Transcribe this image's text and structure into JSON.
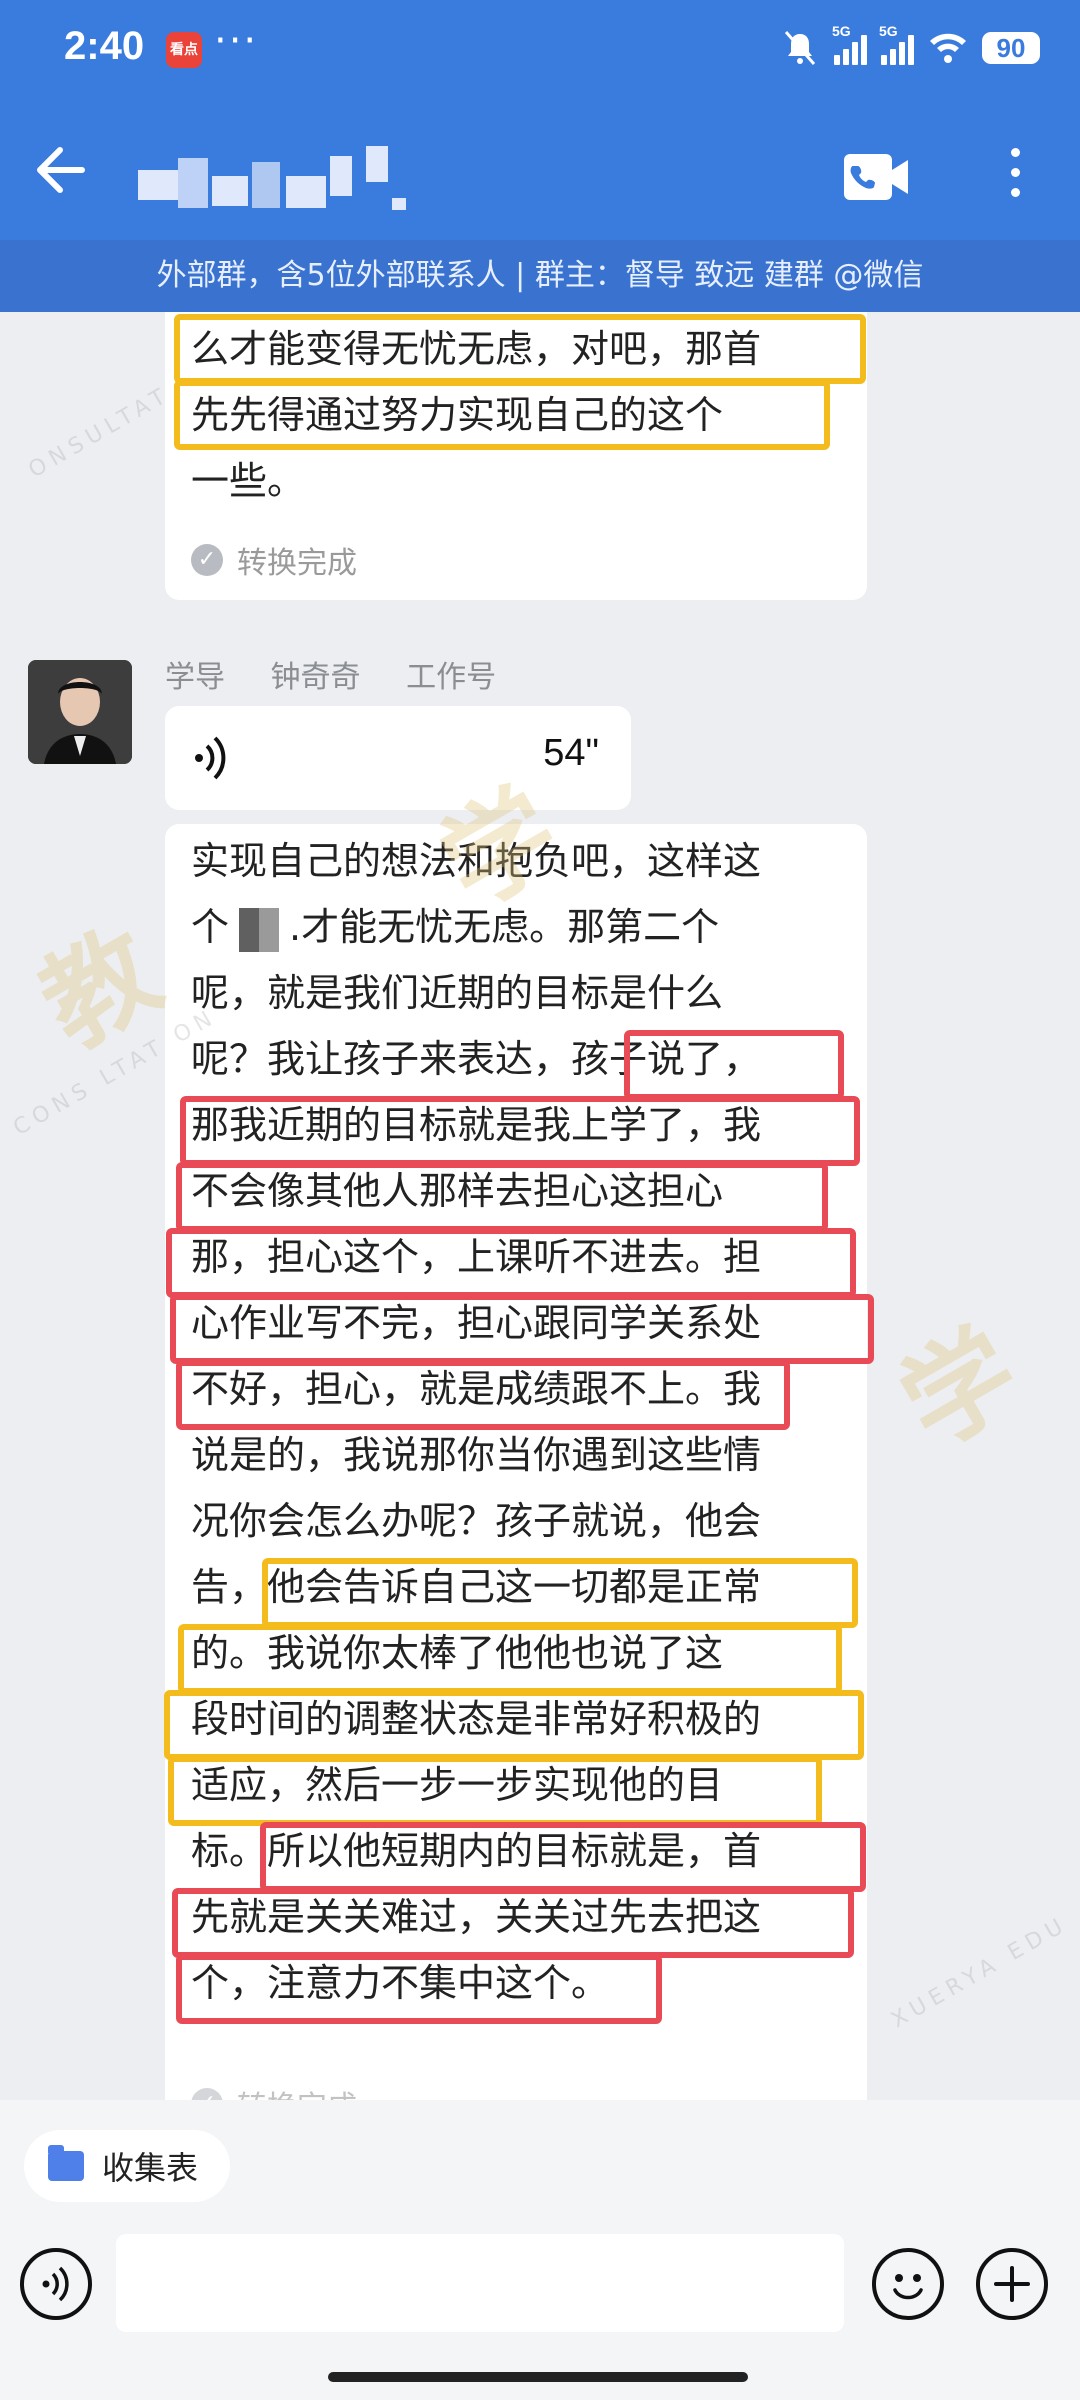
{
  "status_bar": {
    "time": "2:40",
    "app_icon_label": "看点",
    "overflow": "···",
    "signal_1": "5G",
    "signal_2": "5G",
    "battery": "90"
  },
  "header": {
    "title_obscured": "",
    "subtitle": "外部群，含5位外部联系人 | 群主：督导  致远    建群 @微信"
  },
  "messages": [
    {
      "lines": [
        "么才能变得无忧无虑，对吧，那首",
        "先先得通过努力实现自己的这个",
        "一些。"
      ],
      "status": "转换完成"
    },
    {
      "sender": "学导    钟奇奇    工作号",
      "voice_duration": "54\"",
      "lines": [
        {
          "pre": "实现自己的想法和抱负吧，这样这"
        },
        {
          "pre": "个",
          "post": ".才能无忧无虑。那第二个"
        },
        {
          "pre": "呢，就是我们近期的目标是什么"
        },
        {
          "pre": "呢？我让孩子来表达，孩子说了，"
        },
        {
          "pre": "那我近期的目标就是我上学了，我"
        },
        {
          "pre": "不会像其他人那样去担心这担心"
        },
        {
          "pre": "那，担心这个，上课听不进去。担"
        },
        {
          "pre": "心作业写不完，担心跟同学关系处"
        },
        {
          "pre": "不好，担心，就是成绩跟不上。我"
        },
        {
          "pre": "说是的，我说那你当你遇到这些情"
        },
        {
          "pre": "况你会怎么办呢？孩子就说，他会"
        },
        {
          "pre": "告，他会告诉自己这一切都是正常"
        },
        {
          "pre": "的。我说你太棒了他他也说了这"
        },
        {
          "pre": "段时间的调整状态是非常好积极的"
        },
        {
          "pre": "适应，然后一步一步实现他的目"
        },
        {
          "pre": "标。所以他短期内的目标就是，首"
        },
        {
          "pre": "先就是关关难过，关关过先去把这"
        },
        {
          "pre": "个，注意力不集中这个。"
        }
      ],
      "status_partial": "转换完成"
    }
  ],
  "bottom": {
    "chip_label": "收集表"
  },
  "icons": {
    "back": "back-arrow-icon",
    "call": "video-call-icon",
    "more": "more-vert-icon",
    "voice": "voice-input-icon",
    "emoji": "emoji-icon",
    "plus": "plus-icon"
  },
  "colors": {
    "header_blue": "#3a7bde",
    "highlight_yellow": "#f3bb1c",
    "highlight_red": "#e94b56"
  }
}
